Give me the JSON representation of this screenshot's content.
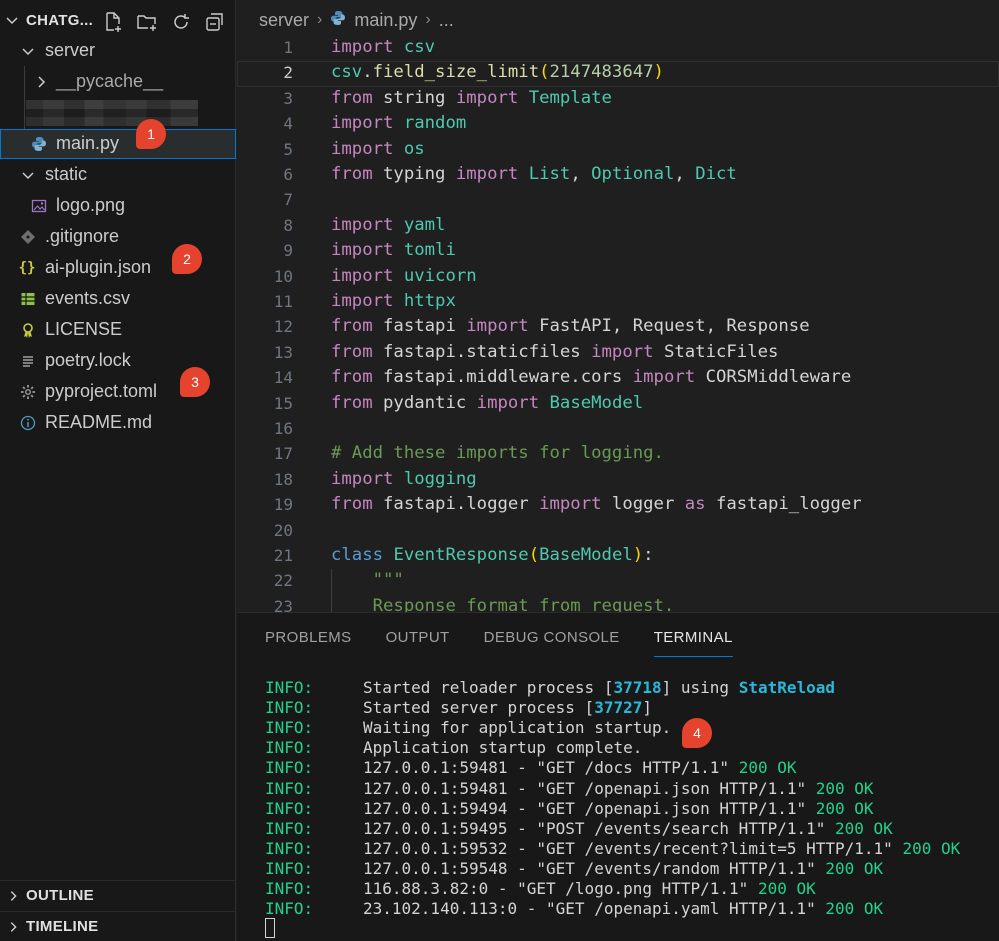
{
  "explorer": {
    "title": "CHATG...",
    "actions": [
      "new-file-icon",
      "new-folder-icon",
      "refresh-icon",
      "collapse-all-icon"
    ],
    "tree": [
      {
        "label": "server",
        "kind": "folder-open"
      },
      {
        "label": "__pycache__",
        "kind": "folder-closed"
      },
      {
        "label": "main.py",
        "kind": "python-file",
        "selected": true
      },
      {
        "label": "static",
        "kind": "folder-open"
      },
      {
        "label": "logo.png",
        "kind": "image-file"
      },
      {
        "label": ".gitignore",
        "kind": "git-file"
      },
      {
        "label": "ai-plugin.json",
        "kind": "json-file"
      },
      {
        "label": "events.csv",
        "kind": "csv-file"
      },
      {
        "label": "LICENSE",
        "kind": "license-file"
      },
      {
        "label": "poetry.lock",
        "kind": "lock-file"
      },
      {
        "label": "pyproject.toml",
        "kind": "toml-file"
      },
      {
        "label": "README.md",
        "kind": "info-file"
      }
    ],
    "outline_label": "OUTLINE",
    "timeline_label": "TIMELINE"
  },
  "badges": [
    "1",
    "2",
    "3",
    "4"
  ],
  "editor": {
    "breadcrumb": {
      "folder": "server",
      "file": "main.py",
      "more": "..."
    },
    "current_line": 2,
    "line_numbers": [
      "1",
      "2",
      "3",
      "4",
      "5",
      "6",
      "7",
      "8",
      "9",
      "10",
      "11",
      "12",
      "13",
      "14",
      "15",
      "16",
      "17",
      "18",
      "19",
      "20",
      "21",
      "22",
      "23"
    ],
    "lines": [
      "import csv",
      "csv.field_size_limit(2147483647)",
      "from string import Template",
      "import random",
      "import os",
      "from typing import List, Optional, Dict",
      "",
      "import yaml",
      "import tomli",
      "import uvicorn",
      "import httpx",
      "from fastapi import FastAPI, Request, Response",
      "from fastapi.staticfiles import StaticFiles",
      "from fastapi.middleware.cors import CORSMiddleware",
      "from pydantic import BaseModel",
      "",
      "# Add these imports for logging.",
      "import logging",
      "from fastapi.logger import logger as fastapi_logger",
      "",
      "class EventResponse(BaseModel):",
      "    \"\"\"",
      "    Response format from request."
    ]
  },
  "panel": {
    "tabs": [
      "PROBLEMS",
      "OUTPUT",
      "DEBUG CONSOLE",
      "TERMINAL"
    ],
    "active_tab": "TERMINAL",
    "terminal": [
      {
        "level": "INFO:",
        "parts": [
          [
            "Started reloader process [",
            ""
          ],
          [
            "37718",
            "num"
          ],
          [
            "] using ",
            ""
          ],
          [
            "StatReload",
            "num"
          ]
        ]
      },
      {
        "level": "INFO:",
        "parts": [
          [
            "Started server process [",
            ""
          ],
          [
            "37727",
            "num"
          ],
          [
            "]",
            ""
          ]
        ]
      },
      {
        "level": "INFO:",
        "parts": [
          [
            "Waiting for application startup.",
            ""
          ]
        ]
      },
      {
        "level": "INFO:",
        "parts": [
          [
            "Application startup complete.",
            ""
          ]
        ]
      },
      {
        "level": "INFO:",
        "parts": [
          [
            "127.0.0.1:59481 - \"GET /docs HTTP/1.1\" ",
            ""
          ],
          [
            "200 OK",
            "ok"
          ]
        ]
      },
      {
        "level": "INFO:",
        "parts": [
          [
            "127.0.0.1:59481 - \"GET /openapi.json HTTP/1.1\" ",
            ""
          ],
          [
            "200 OK",
            "ok"
          ]
        ]
      },
      {
        "level": "INFO:",
        "parts": [
          [
            "127.0.0.1:59494 - \"GET /openapi.json HTTP/1.1\" ",
            ""
          ],
          [
            "200 OK",
            "ok"
          ]
        ]
      },
      {
        "level": "INFO:",
        "parts": [
          [
            "127.0.0.1:59495 - \"POST /events/search HTTP/1.1\" ",
            ""
          ],
          [
            "200 OK",
            "ok"
          ]
        ]
      },
      {
        "level": "INFO:",
        "parts": [
          [
            "127.0.0.1:59532 - \"GET /events/recent?limit=5 HTTP/1.1\" ",
            ""
          ],
          [
            "200 OK",
            "ok"
          ]
        ]
      },
      {
        "level": "INFO:",
        "parts": [
          [
            "127.0.0.1:59548 - \"GET /events/random HTTP/1.1\" ",
            ""
          ],
          [
            "200 OK",
            "ok"
          ]
        ]
      },
      {
        "level": "INFO:",
        "parts": [
          [
            "116.88.3.82:0 - \"GET /logo.png HTTP/1.1\" ",
            ""
          ],
          [
            "200 OK",
            "ok"
          ]
        ]
      },
      {
        "level": "INFO:",
        "parts": [
          [
            "23.102.140.113:0 - \"GET /openapi.yaml HTTP/1.1\" ",
            ""
          ],
          [
            "200 OK",
            "ok"
          ]
        ]
      }
    ]
  },
  "colors": {
    "accent": "#0078d4",
    "badge": "#e5432d",
    "terminal_info": "#23d18b",
    "terminal_number": "#29b8db"
  }
}
